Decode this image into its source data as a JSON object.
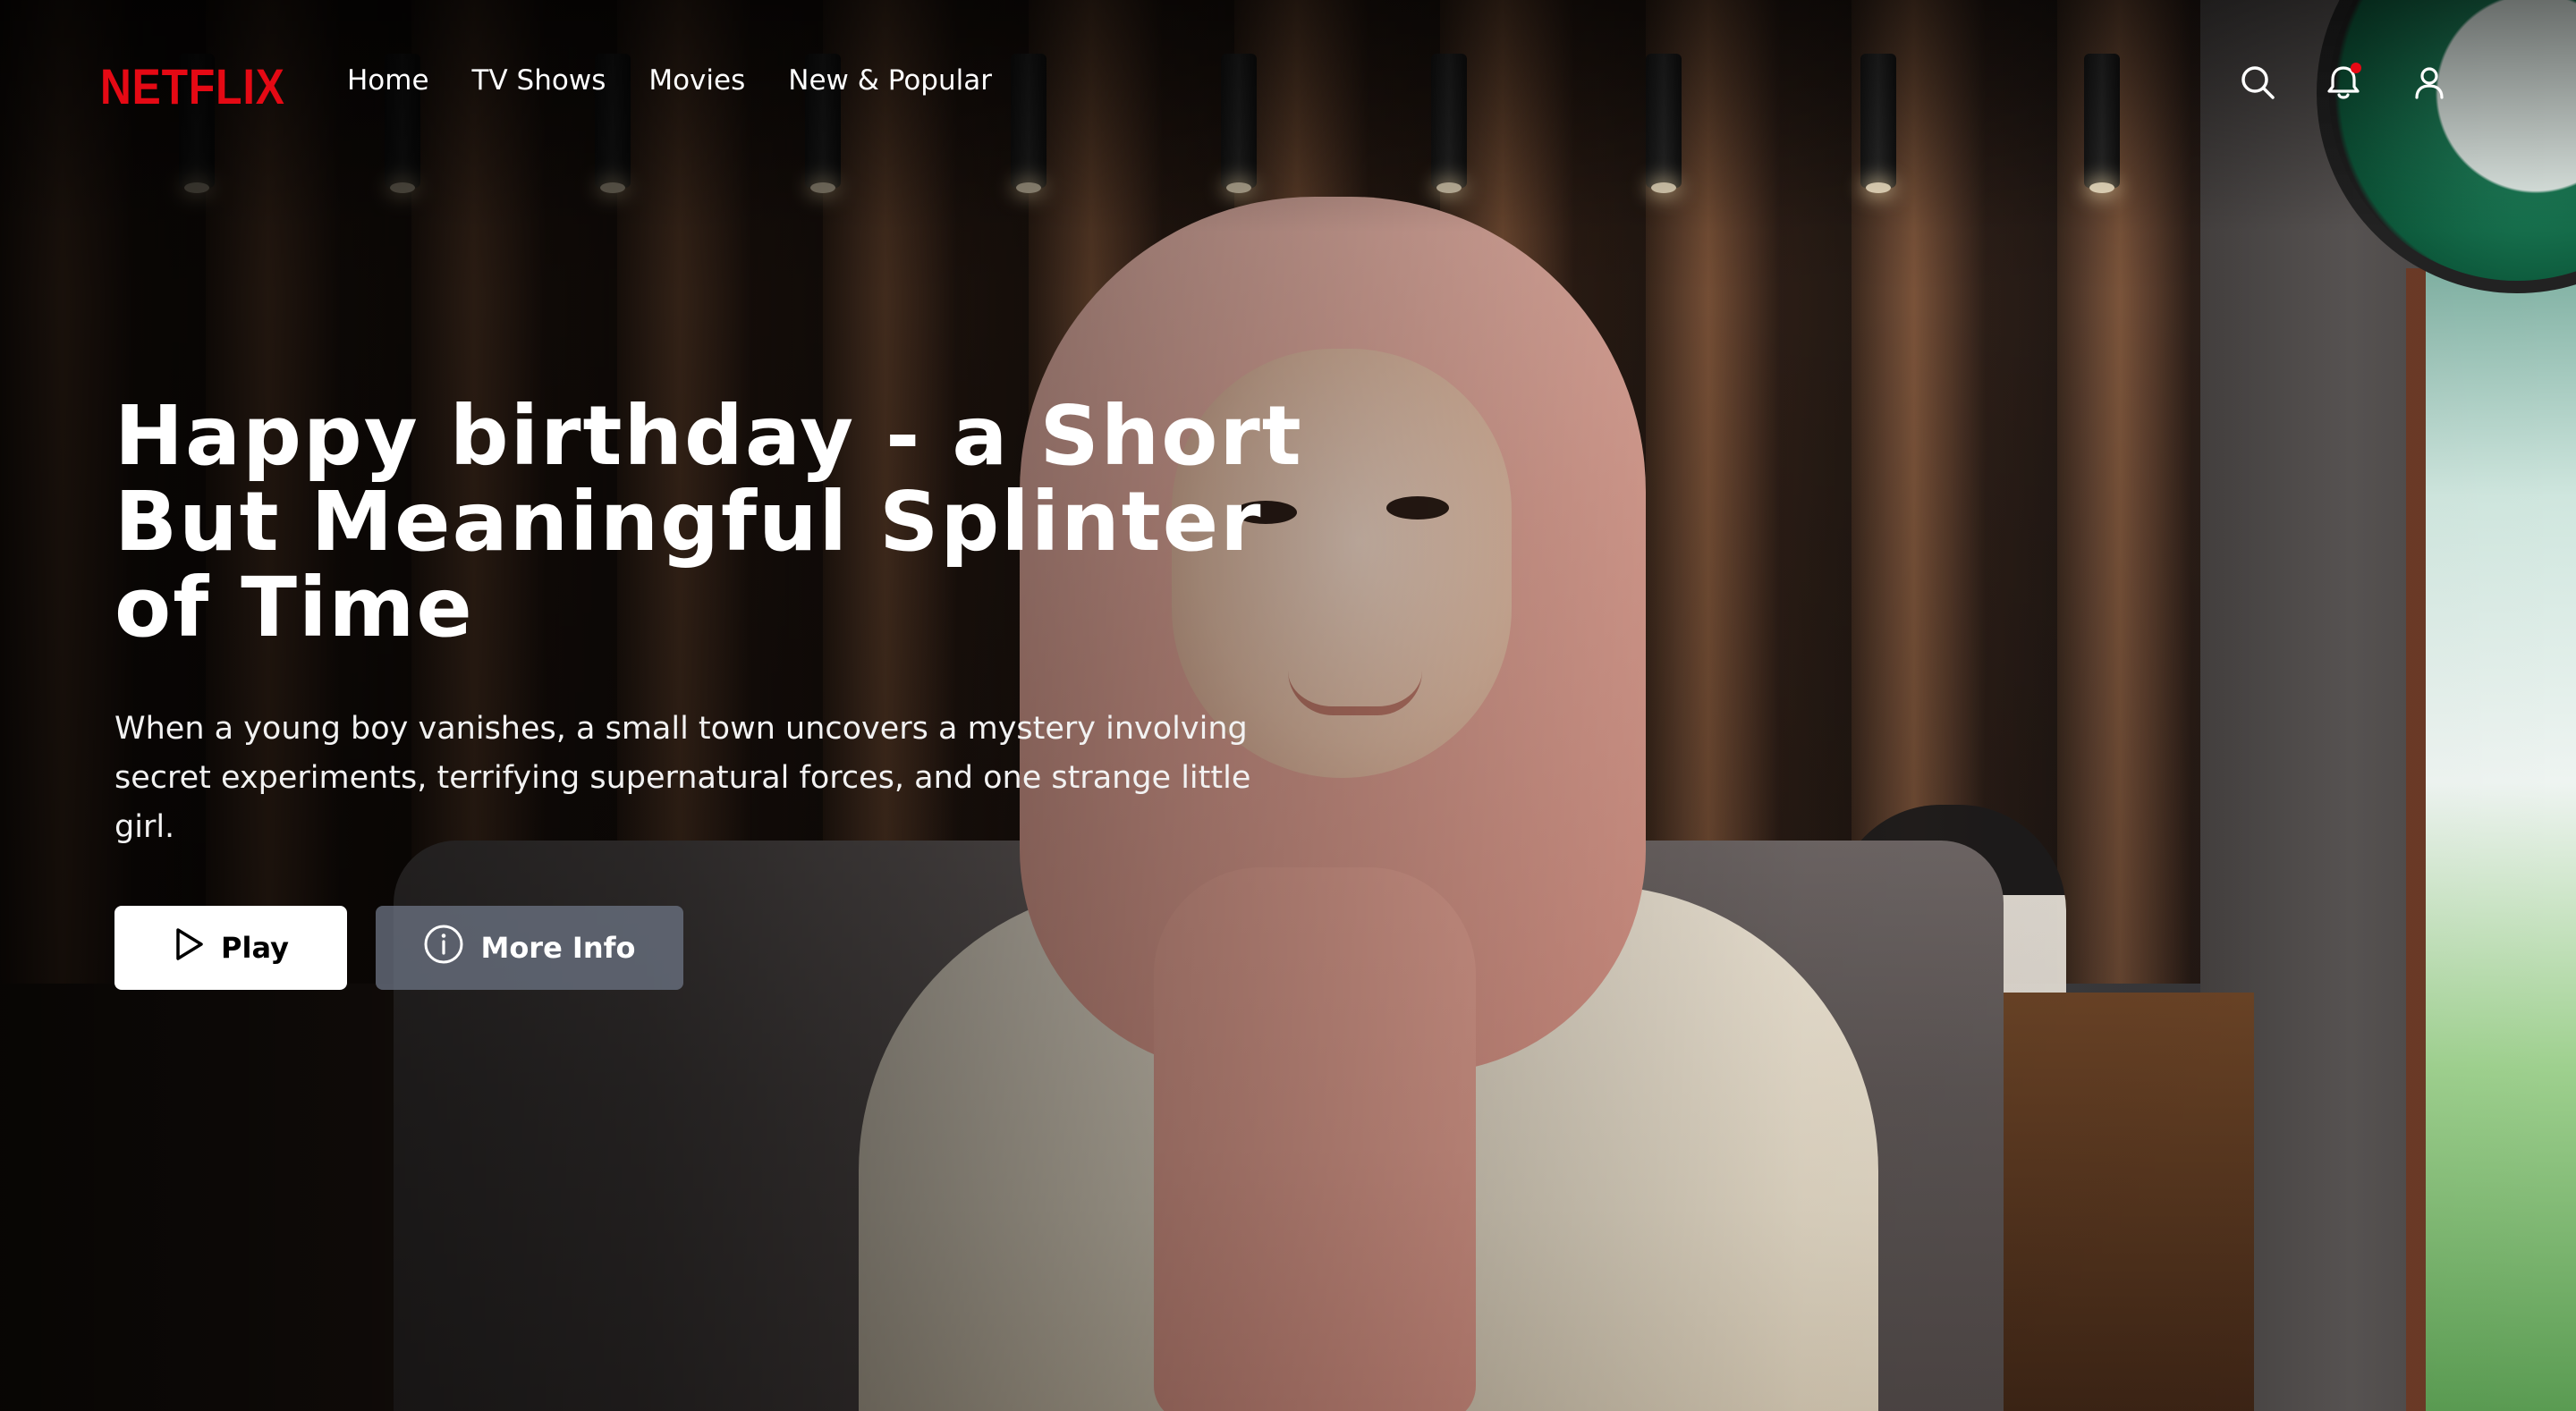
{
  "brand": {
    "logo_text": "NETFLIX",
    "accent_color": "#e50914"
  },
  "nav": {
    "links": [
      {
        "label": "Home"
      },
      {
        "label": "TV Shows"
      },
      {
        "label": "Movies"
      },
      {
        "label": "New & Popular"
      }
    ],
    "icons": {
      "search": "search-icon",
      "notifications": "bell-icon",
      "profile": "user-icon"
    },
    "notification_dot_color": "#e50914"
  },
  "hero": {
    "title": "Happy birthday - a Short But Meaningful Splinter of Time",
    "description": "When a young boy vanishes, a small town uncovers a mystery involving secret experiments, terrifying supernatural forces, and one strange little girl.",
    "play_label": "Play",
    "more_info_label": "More Info"
  }
}
